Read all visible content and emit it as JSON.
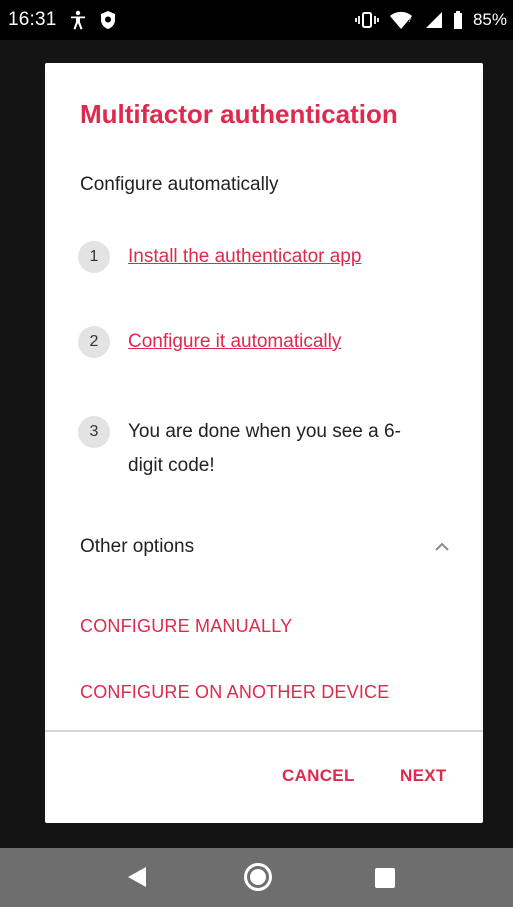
{
  "status_bar": {
    "time": "16:31",
    "battery": "85%",
    "icons": [
      "accessibility-icon",
      "shield-icon",
      "vibrate-icon",
      "wifi-icon",
      "signal-icon",
      "battery-icon"
    ]
  },
  "dialog": {
    "title": "Multifactor authentication",
    "subtitle": "Configure automatically",
    "steps": [
      {
        "number": "1",
        "text": "Install the authenticator app",
        "link": true
      },
      {
        "number": "2",
        "text": "Configure it automatically",
        "link": true
      },
      {
        "number": "3",
        "text": "You are done when you see a 6-digit code!",
        "link": false
      }
    ],
    "other_options": {
      "label": "Other options",
      "icon": "chevron-up-icon"
    },
    "actions": [
      {
        "label": "CONFIGURE MANUALLY"
      },
      {
        "label": "CONFIGURE ON ANOTHER DEVICE"
      }
    ],
    "footer": {
      "cancel": "CANCEL",
      "next": "NEXT"
    }
  },
  "nav_bar": {
    "icons": [
      "back-icon",
      "home-icon",
      "recents-icon"
    ]
  },
  "colors": {
    "accent": "#e0294d",
    "status_bar": "#000000",
    "nav_bar": "#6e6e6e",
    "scrim": "#141414"
  }
}
